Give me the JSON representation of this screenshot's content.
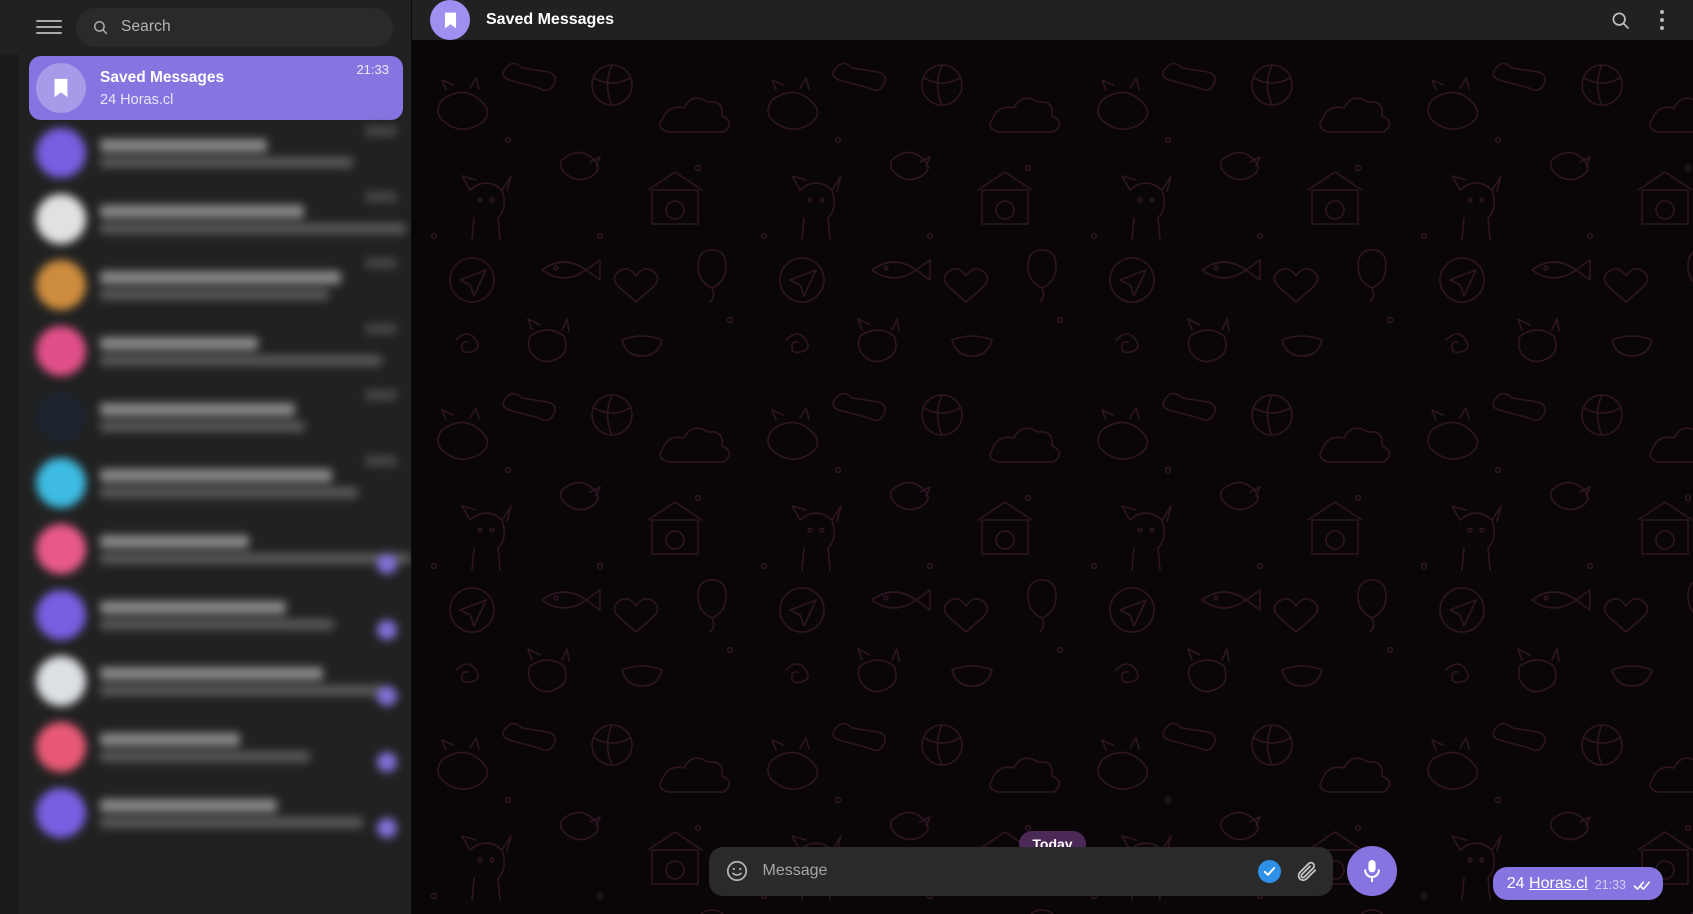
{
  "theme": {
    "accent": "#8774e1",
    "sidebar_bg": "#212121",
    "chat_bg": "#0a0608",
    "blue_check": "#2f90e8",
    "selected_row_bg": "#8774e1",
    "date_pill_bg": "#5c336e"
  },
  "sidebar": {
    "menu_icon": "hamburger-icon",
    "search": {
      "icon": "search-icon",
      "placeholder": "Search",
      "value": ""
    },
    "chats": [
      {
        "title": "Saved Messages",
        "subtitle": "24 Horas.cl",
        "time": "21:33",
        "avatar_icon": "bookmark-icon",
        "avatar_color": "#a396e8",
        "selected": true,
        "unread": false,
        "redacted": false
      },
      {
        "title": "",
        "subtitle": "",
        "time": "",
        "avatar_color": "#7b61e8",
        "selected": false,
        "unread": false,
        "redacted": true
      },
      {
        "title": "",
        "subtitle": "",
        "time": "",
        "avatar_color": "#e8e8e8",
        "selected": false,
        "unread": false,
        "redacted": true
      },
      {
        "title": "",
        "subtitle": "",
        "time": "",
        "avatar_color": "#d4903f",
        "selected": false,
        "unread": false,
        "redacted": true
      },
      {
        "title": "",
        "subtitle": "",
        "time": "",
        "avatar_color": "#e8518c",
        "selected": false,
        "unread": false,
        "redacted": true
      },
      {
        "title": "",
        "subtitle": "",
        "time": "",
        "avatar_color": "#1c2430",
        "selected": false,
        "unread": false,
        "redacted": true
      },
      {
        "title": "",
        "subtitle": "",
        "time": "",
        "avatar_color": "#3ec0e8",
        "selected": false,
        "unread": false,
        "redacted": true
      },
      {
        "title": "",
        "subtitle": "",
        "time": "",
        "avatar_color": "#ef5b8f",
        "selected": false,
        "unread": true,
        "redacted": true
      },
      {
        "title": "",
        "subtitle": "",
        "time": "",
        "avatar_color": "#7b61e8",
        "selected": false,
        "unread": true,
        "redacted": true
      },
      {
        "title": "",
        "subtitle": "",
        "time": "",
        "avatar_color": "#e3e6ea",
        "selected": false,
        "unread": true,
        "redacted": true
      },
      {
        "title": "",
        "subtitle": "",
        "time": "",
        "avatar_color": "#ef5b78",
        "selected": false,
        "unread": true,
        "redacted": true
      },
      {
        "title": "",
        "subtitle": "",
        "time": "",
        "avatar_color": "#7b61e8",
        "selected": false,
        "unread": true,
        "redacted": true
      }
    ]
  },
  "chat_header": {
    "avatar_icon": "bookmark-icon",
    "title": "Saved Messages",
    "search_icon": "search-icon",
    "menu_icon": "more-vertical-icon"
  },
  "conversation": {
    "date_separator": "Today",
    "messages": [
      {
        "text_plain": "24 ",
        "text_link": "Horas.cl",
        "time": "21:33",
        "status_icon": "double-check-icon",
        "outgoing": true
      }
    ]
  },
  "composer": {
    "emoji_icon": "smiley-icon",
    "placeholder": "Message",
    "value": "",
    "confirm_icon": "check-circle-icon",
    "attach_icon": "paperclip-icon",
    "record_icon": "microphone-icon"
  }
}
